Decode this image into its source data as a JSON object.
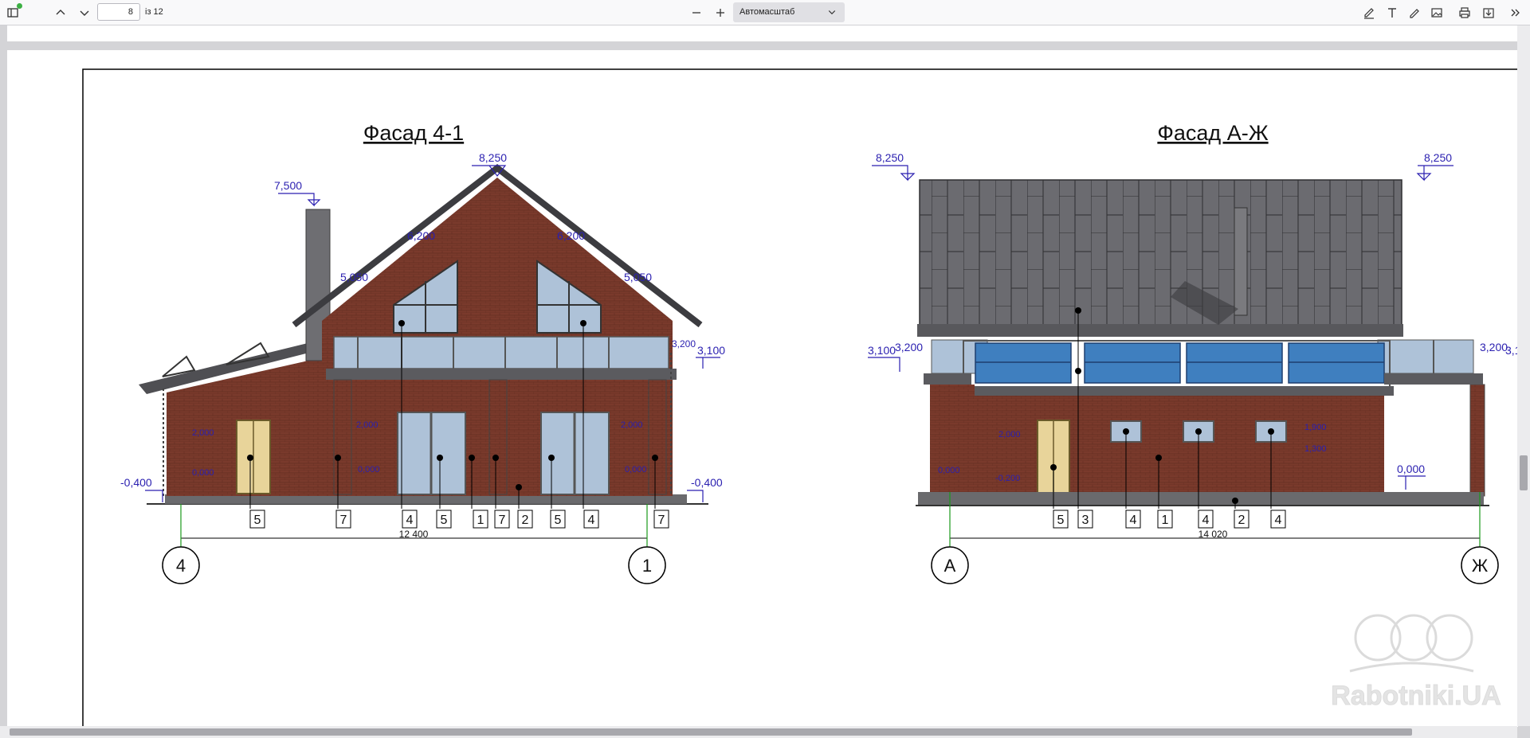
{
  "toolbar": {
    "sidebar_icon": "sidebar-toggle-icon",
    "prev_icon": "chevron-up-icon",
    "next_icon": "chevron-down-icon",
    "page_number": "8",
    "page_count": "із 12",
    "zoom_out_icon": "minus-icon",
    "zoom_in_icon": "plus-icon",
    "zoom_value": "Автомасштаб",
    "tools": [
      "highlight-icon",
      "text-icon",
      "draw-icon",
      "image-icon",
      "print-icon",
      "save-icon",
      "more-tools-icon"
    ]
  },
  "drawing": {
    "left": {
      "title": "Фасад 4-1",
      "levels": {
        "ridge": "8,250",
        "chimney": "7,500",
        "window_left": "6,200",
        "window_right": "6,200",
        "eave_left": "5,050",
        "eave_right": "5,050",
        "terrace": "3,200",
        "terrace2": "3,100",
        "ground_left": "-0,400",
        "ground_right": "-0,400",
        "door_top": "2,000",
        "win_mid_l": "2,000",
        "win_mid_r": "2,000",
        "plinth_l": "0,000",
        "plinth_m": "0,000",
        "plinth_r": "0,000"
      },
      "callouts": [
        "5",
        "7",
        "4",
        "5",
        "1",
        "7",
        "2",
        "5",
        "4",
        "7"
      ],
      "dimension": "12 400",
      "axis_left": "4",
      "axis_right": "1"
    },
    "right": {
      "title": "Фасад А-Ж",
      "levels": {
        "ridge_left": "8,250",
        "ridge_right": "8,250",
        "eave_left_a": "3,100",
        "eave_left_b": "3,200",
        "eave_right_a": "3,200",
        "eave_right_b": "3,1",
        "ground": "0,000",
        "door_top": "2,000",
        "plinth": "0,000",
        "plinth2": "-0,200",
        "win_top": "1,900",
        "win_bottom": "1,300"
      },
      "callouts": [
        "5",
        "3",
        "4",
        "1",
        "4",
        "2",
        "4"
      ],
      "dimension": "14 020",
      "axis_left": "А",
      "axis_right": "Ж"
    },
    "watermark": "Rabotniki.UA"
  },
  "colors": {
    "brick": "#7a3a2c",
    "roof_dark": "#5a5a5e",
    "glass": "#aec2d8",
    "solar": "#3f7fbf",
    "dim_blue": "#2a1fb0"
  }
}
